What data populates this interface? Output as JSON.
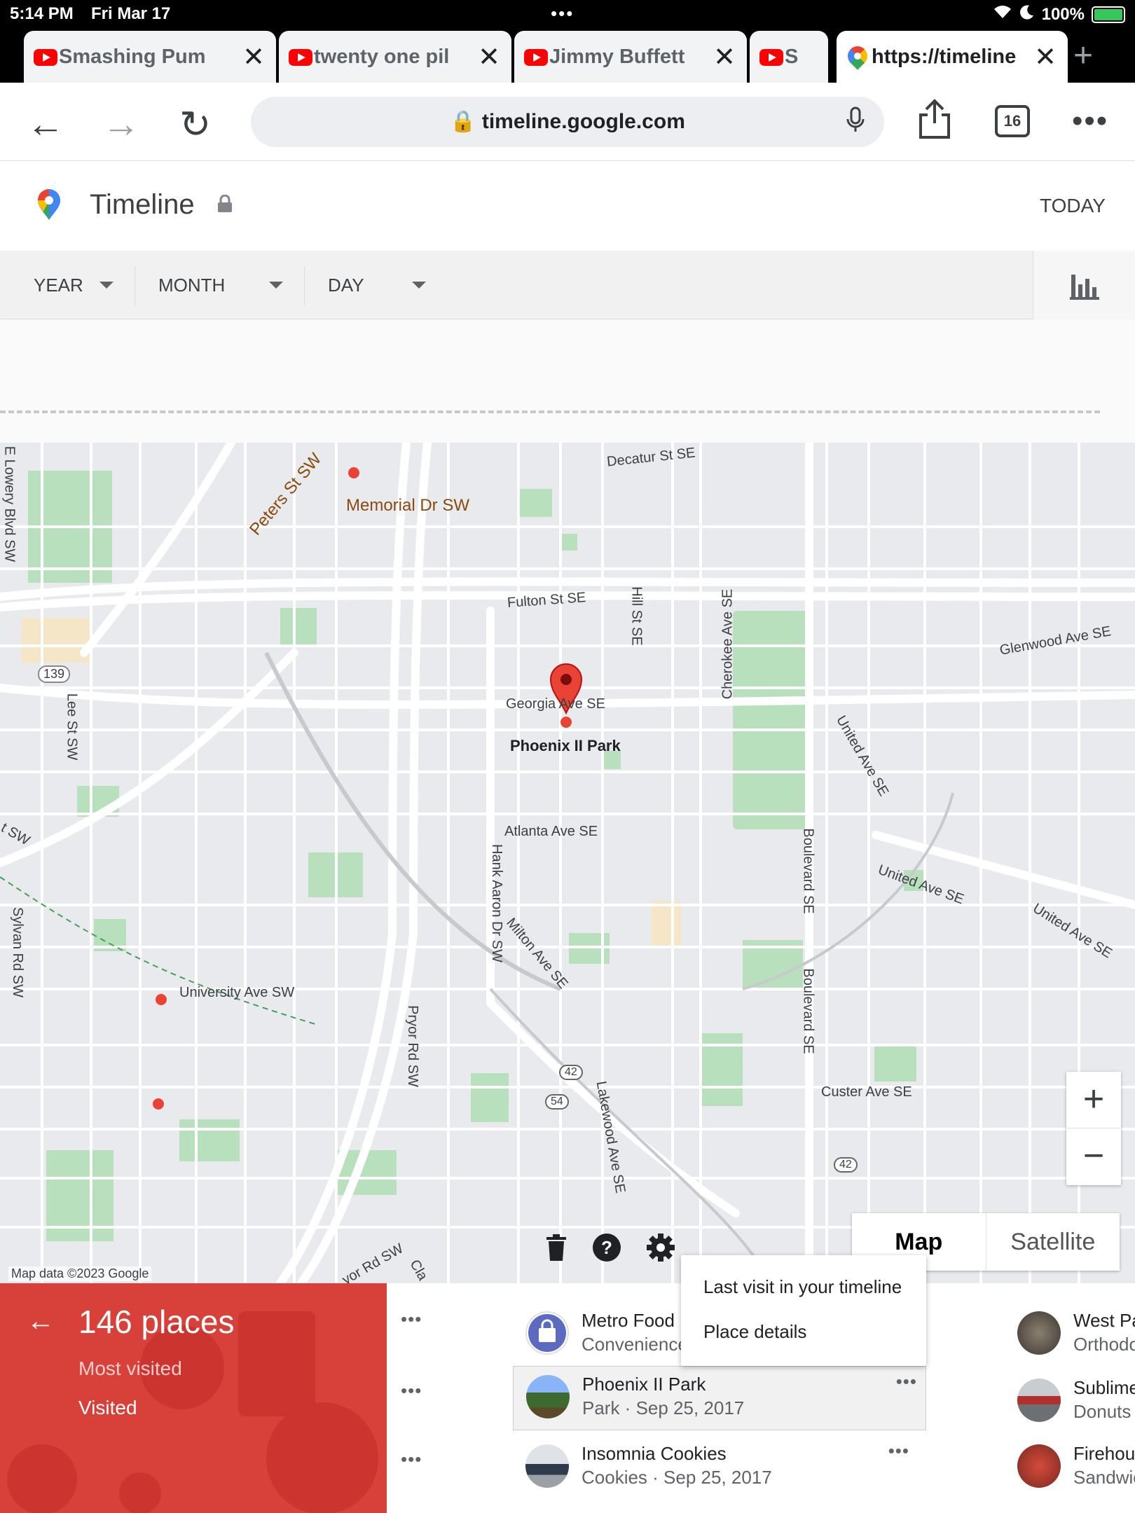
{
  "status": {
    "time": "5:14 PM",
    "date": "Fri Mar 17",
    "battery": "100%"
  },
  "tabs": [
    {
      "label": "Smashing Pum",
      "icon": "youtube-icon"
    },
    {
      "label": "twenty one pil",
      "icon": "youtube-icon"
    },
    {
      "label": "Jimmy Buffett",
      "icon": "youtube-icon"
    },
    {
      "label": "S",
      "icon": "youtube-icon"
    },
    {
      "label": "https://timeline",
      "icon": "google-maps-icon",
      "active": true
    }
  ],
  "address": {
    "url": "timeline.google.com",
    "tab_count": "16"
  },
  "timeline": {
    "title": "Timeline",
    "today": "TODAY",
    "year": "YEAR",
    "month": "MONTH",
    "day": "DAY"
  },
  "map": {
    "labels": {
      "decatur": "Decatur St SE",
      "peters": "Peters St SW",
      "memorial": "Memorial Dr SW",
      "lowery": "E Lowery Blvd SW",
      "fulton": "Fulton St SE",
      "hill": "Hill St SE",
      "cherokee": "Cherokee Ave SE",
      "glenwood": "Glenwood Ave SE",
      "r139": "139",
      "lee": "Lee St SW",
      "georgia": "Georgia Ave SE",
      "phoenix": "Phoenix II Park",
      "united1": "United Ave SE",
      "united2": "United Ave SE",
      "united3": "United Ave SE",
      "sw": "t SW",
      "atlanta": "Atlanta Ave SE",
      "hankaaron": "Hank Aaron Dr SW",
      "boulevard1": "Boulevard SE",
      "boulevard2": "Boulevard SE",
      "milton": "Milton Ave SE",
      "sylvan": "Sylvan Rd SW",
      "university": "University Ave SW",
      "pryor": "Pryor Rd SW",
      "r42a": "42",
      "r54": "54",
      "lakewood": "Lakewood Ave SE",
      "custer": "Custer Ave SE",
      "r42b": "42",
      "pryor2": "yor Rd SW",
      "cla": "Cla"
    },
    "map_btn": "Map",
    "satellite_btn": "Satellite",
    "attribution": "Map data ©2023 Google",
    "zoom_in": "+",
    "zoom_out": "−"
  },
  "panel": {
    "count": "146 places",
    "most_visited": "Most visited",
    "visited": "Visited"
  },
  "places": [
    {
      "name": "Metro Food",
      "sub": "Convenience"
    },
    {
      "name": "Phoenix II Park",
      "sub": "Park · Sep 25, 2017"
    },
    {
      "name": "Insomnia Cookies",
      "sub": "Cookies · Sep 25, 2017"
    },
    {
      "name": "West Pa",
      "sub": "Orthodo"
    },
    {
      "name": "Sublime",
      "sub": "Donuts"
    },
    {
      "name": "Firehou",
      "sub": "Sandwic"
    }
  ],
  "menu": {
    "last_visit": "Last visit in your timeline",
    "place_details": "Place details"
  }
}
